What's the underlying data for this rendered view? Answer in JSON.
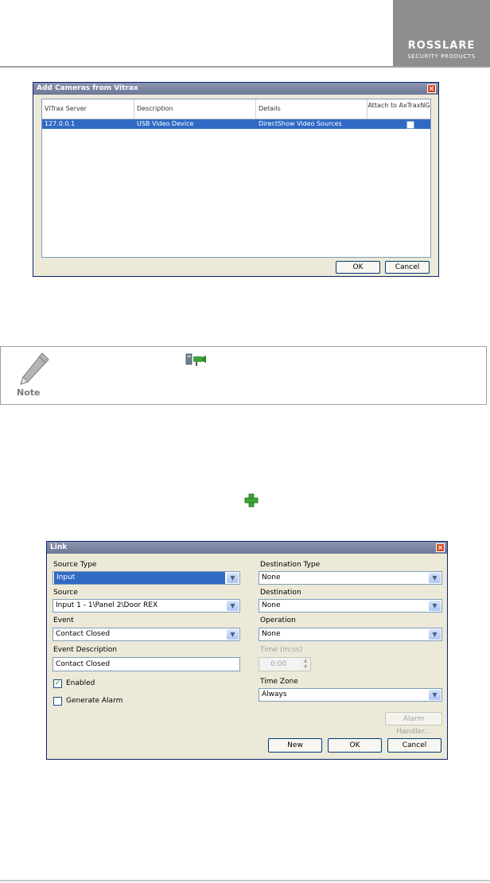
{
  "header": {
    "brand_name": "ROSSLARE",
    "brand_tagline": "SECURITY PRODUCTS"
  },
  "add_cameras_dialog": {
    "title": "Add Cameras from Vitrax",
    "columns": [
      "ViTrax Server",
      "Description",
      "Details",
      "Attach to AxTraxNG"
    ],
    "rows": [
      {
        "server": "127.0.0.1",
        "description": "USB Video Device",
        "details": "DirectShow Video Sources",
        "attach": false
      }
    ],
    "ok_label": "OK",
    "cancel_label": "Cancel"
  },
  "note": {
    "label": "Note",
    "icon": "camera-device-icon"
  },
  "add_icon": "green-plus-icon",
  "link_dialog": {
    "title": "Link",
    "source_type_label": "Source Type",
    "source_type_value": "Input",
    "source_label": "Source",
    "source_value": "Input 1 - 1\\Panel 2\\Door REX",
    "event_label": "Event",
    "event_value": "Contact Closed",
    "event_description_label": "Event Description",
    "event_description_value": "Contact Closed",
    "enabled_label": "Enabled",
    "enabled_checked": true,
    "generate_alarm_label": "Generate Alarm",
    "generate_alarm_checked": false,
    "destination_type_label": "Destination Type",
    "destination_type_value": "None",
    "destination_label": "Destination",
    "destination_value": "None",
    "operation_label": "Operation",
    "operation_value": "None",
    "time_label": "Time (m:ss)",
    "time_value": "0:00",
    "time_zone_label": "Time Zone",
    "time_zone_value": "Always",
    "alarm_handler_label": "Alarm Handler...",
    "new_label": "New",
    "ok_label": "OK",
    "cancel_label": "Cancel"
  }
}
